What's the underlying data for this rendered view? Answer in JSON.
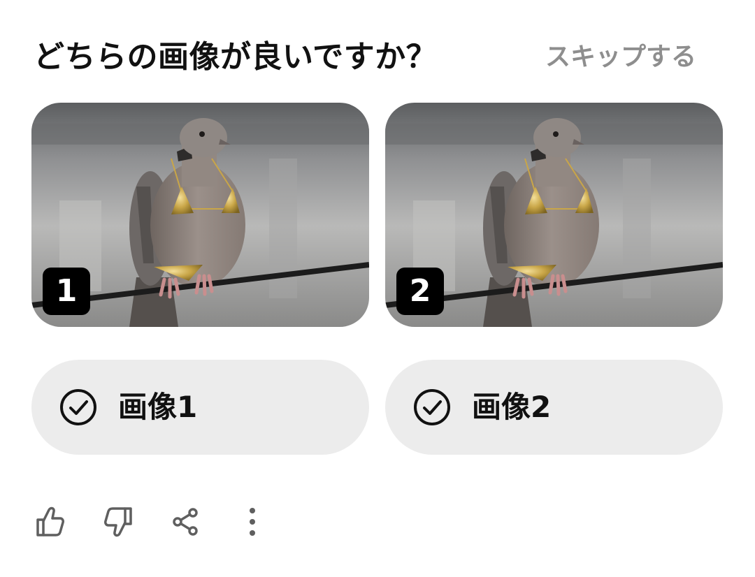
{
  "header": {
    "question": "どちらの画像が良いですか？",
    "skip_label": "スキップする"
  },
  "images": [
    {
      "badge": "1",
      "choice_label": "画像1"
    },
    {
      "badge": "2",
      "choice_label": "画像2"
    }
  ],
  "actions": {
    "icons": [
      "thumbs-up-icon",
      "thumbs-down-icon",
      "share-icon",
      "more-vert-icon"
    ]
  },
  "colors": {
    "badge_bg": "#000000",
    "choice_bg": "#ececec",
    "skip_text": "#8e8e8e",
    "icon_gray": "#5f5f5f"
  }
}
